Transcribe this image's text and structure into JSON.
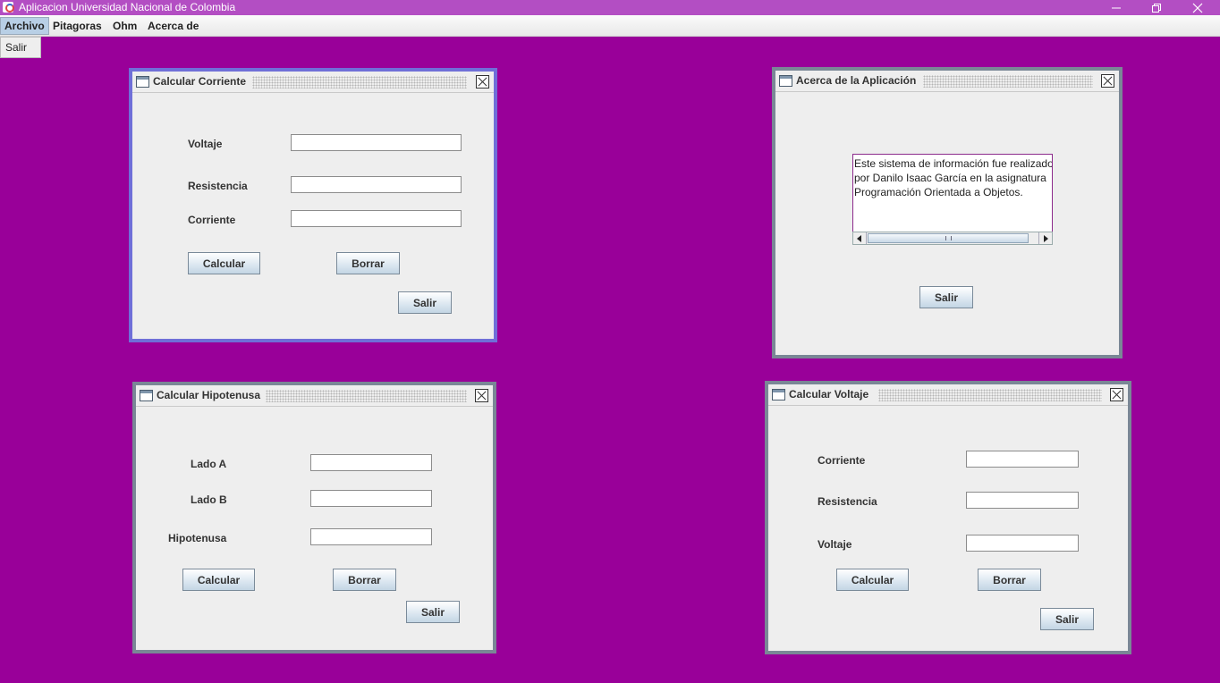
{
  "window": {
    "title": "Aplicacion Universidad Nacional de Colombia"
  },
  "menubar": {
    "items": [
      {
        "label": "Archivo"
      },
      {
        "label": "Pitagoras"
      },
      {
        "label": "Ohm"
      },
      {
        "label": "Acerca de"
      }
    ],
    "dropdown": {
      "items": [
        {
          "label": "Salir"
        }
      ]
    }
  },
  "corriente_frame": {
    "title": "Calcular Corriente",
    "voltaje_label": "Voltaje",
    "voltaje_value": "",
    "resistencia_label": "Resistencia",
    "resistencia_value": "",
    "corriente_label": "Corriente",
    "corriente_value": "",
    "calcular_label": "Calcular",
    "borrar_label": "Borrar",
    "salir_label": "Salir"
  },
  "acerca_frame": {
    "title": "Acerca de la Aplicación",
    "text_lines": [
      "Este sistema de información fue realizado",
      "por Danilo Isaac García en la asignatura",
      "Programación Orientada a Objetos."
    ],
    "salir_label": "Salir"
  },
  "hipotenusa_frame": {
    "title": "Calcular Hipotenusa",
    "lado_a_label": "Lado A",
    "lado_a_value": "",
    "lado_b_label": "Lado B",
    "lado_b_value": "",
    "hipotenusa_label": "Hipotenusa",
    "hipotenusa_value": "",
    "calcular_label": "Calcular",
    "borrar_label": "Borrar",
    "salir_label": "Salir"
  },
  "voltaje_frame": {
    "title": "Calcular Voltaje",
    "corriente_label": "Corriente",
    "corriente_value": "",
    "resistencia_label": "Resistencia",
    "resistencia_value": "",
    "voltaje_label": "Voltaje",
    "voltaje_value": "",
    "calcular_label": "Calcular",
    "borrar_label": "Borrar",
    "salir_label": "Salir"
  },
  "colors": {
    "desktop": "#990099",
    "titlebar": "#b34ec3",
    "frame_selected_border": "#6f6fd8",
    "frame_border": "#7a8796"
  },
  "icons": {
    "app": "java-cup-icon",
    "frame": "window-icon",
    "frame_close": "close-box-icon",
    "minimize": "minimize-icon",
    "maximize": "restore-icon",
    "close": "close-icon"
  }
}
